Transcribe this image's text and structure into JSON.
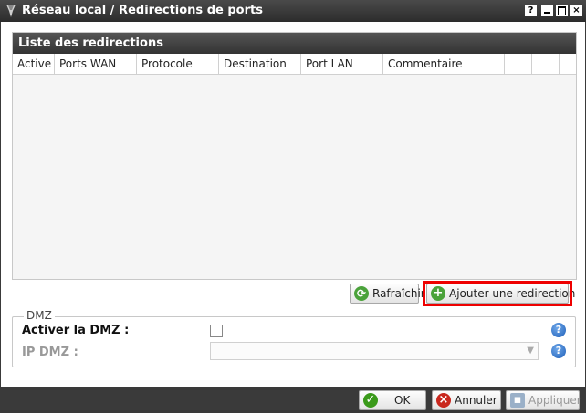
{
  "window": {
    "title": "Réseau local / Redirections de ports",
    "help_label": "?",
    "minimize_label": "",
    "maximize_label": "",
    "close_label": "×"
  },
  "panel": {
    "title": "Liste des redirections",
    "columns": [
      "Active",
      "Ports WAN",
      "Protocole",
      "Destination",
      "Port LAN",
      "Commentaire",
      "",
      ""
    ]
  },
  "actions": {
    "refresh_label": "Rafraîchir",
    "add_label": "Ajouter une redirection"
  },
  "dmz": {
    "legend": "DMZ",
    "enable_label": "Activer la DMZ :",
    "enabled": false,
    "ip_label": "IP DMZ :",
    "ip_value": ""
  },
  "footer": {
    "ok_label": "OK",
    "cancel_label": "Annuler",
    "apply_label": "Appliquer"
  },
  "colors": {
    "add_highlight": "#e00000",
    "ok_icon": "#3a9a1a",
    "cancel_icon": "#c9281e",
    "help_icon": "#2a6fc9"
  },
  "icons": {
    "refresh": "refresh-icon",
    "add": "add-icon",
    "help": "help-icon",
    "ok": "check-icon",
    "cancel": "cancel-icon",
    "apply": "save-icon"
  }
}
